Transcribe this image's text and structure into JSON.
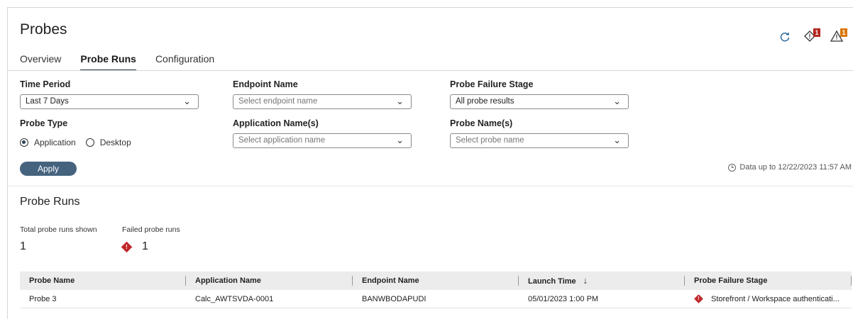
{
  "page": {
    "title": "Probes"
  },
  "tabs": [
    {
      "label": "Overview",
      "active": false
    },
    {
      "label": "Probe Runs",
      "active": true
    },
    {
      "label": "Configuration",
      "active": false
    }
  ],
  "top_icons": {
    "refresh": "refresh-icon",
    "alerts_badge": "1",
    "warnings_badge": "1"
  },
  "filters": {
    "time_period": {
      "label": "Time Period",
      "value": "Last 7 Days"
    },
    "endpoint_name": {
      "label": "Endpoint Name",
      "placeholder": "Select endpoint name"
    },
    "failure_stage": {
      "label": "Probe Failure Stage",
      "value": "All probe results"
    },
    "probe_type": {
      "label": "Probe Type",
      "options": [
        {
          "label": "Application",
          "selected": true
        },
        {
          "label": "Desktop",
          "selected": false
        }
      ]
    },
    "application_names": {
      "label": "Application Name(s)",
      "placeholder": "Select application name"
    },
    "probe_names": {
      "label": "Probe Name(s)",
      "placeholder": "Select probe name"
    },
    "apply_label": "Apply",
    "data_upto": "Data up to 12/22/2023 11:57 AM"
  },
  "probe_runs": {
    "title": "Probe Runs",
    "total_label": "Total probe runs shown",
    "total_value": "1",
    "failed_label": "Failed probe runs",
    "failed_value": "1",
    "columns": [
      "Probe Name",
      "Application Name",
      "Endpoint Name",
      "Launch Time",
      "Probe Failure Stage"
    ],
    "rows": [
      {
        "probe_name": "Probe 3",
        "application_name": "Calc_AWTSVDA-0001",
        "endpoint_name": "BANWBODAPUDI",
        "launch_time": "05/01/2023 1:00 PM",
        "failure_stage": "Storefront / Workspace authenticati..."
      }
    ]
  },
  "colors": {
    "accent": "#45637d",
    "failure": "#c0262b",
    "badge_red": "#b3261e",
    "badge_orange": "#d97706"
  }
}
